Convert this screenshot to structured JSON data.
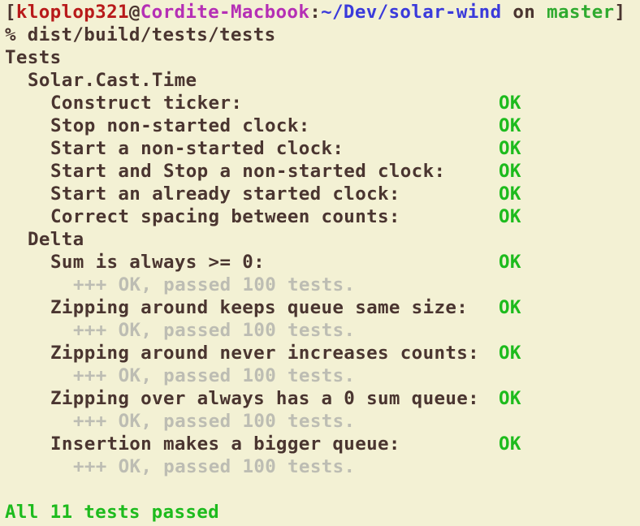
{
  "prompt": {
    "open_bracket": "[",
    "user": "kloplop321",
    "at": "@",
    "host": "Cordite-Macbook",
    "colon": ":",
    "path": "~/Dev/solar-wind",
    "on": " on ",
    "branch": "master",
    "close_bracket": "]"
  },
  "command": "% dist/build/tests/tests",
  "root_group": "Tests",
  "groups": [
    {
      "name": "Solar.Cast.Time",
      "tests": [
        {
          "label": "Construct ticker:",
          "result": "OK"
        },
        {
          "label": "Stop non-started clock:",
          "result": "OK"
        },
        {
          "label": "Start a non-started clock:",
          "result": "OK"
        },
        {
          "label": "Start and Stop a non-started clock:",
          "result": "OK"
        },
        {
          "label": "Start an already started clock:",
          "result": "OK"
        },
        {
          "label": "Correct spacing between counts:",
          "result": "OK"
        }
      ]
    },
    {
      "name": "Delta",
      "tests": [
        {
          "label": "Sum is always >= 0:",
          "result": "OK",
          "detail": "+++ OK, passed 100 tests."
        },
        {
          "label": "Zipping around keeps queue same size:",
          "result": "OK",
          "detail": "+++ OK, passed 100 tests."
        },
        {
          "label": "Zipping around never increases counts:",
          "result": "OK",
          "detail": "+++ OK, passed 100 tests."
        },
        {
          "label": "Zipping over always has a 0 sum queue:",
          "result": "OK",
          "detail": "+++ OK, passed 100 tests."
        },
        {
          "label": "Insertion makes a bigger queue:",
          "result": "OK",
          "detail": "+++ OK, passed 100 tests."
        }
      ]
    }
  ],
  "summary": "All 11 tests passed",
  "colors": {
    "background": "#f3f1d4",
    "text": "#4a3530",
    "user": "#b81a1a",
    "host": "#b52fb5",
    "path": "#3a3adb",
    "branch": "#2faa2f",
    "ok": "#1dbb1d",
    "detail": "#bdbdb3"
  }
}
